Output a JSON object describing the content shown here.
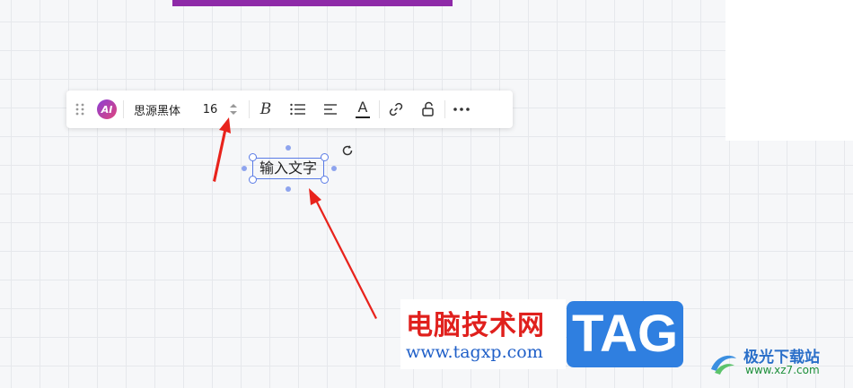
{
  "toolbar": {
    "ai_label": "AI",
    "font_family": "思源黑体",
    "font_size": "16",
    "bold_label": "B",
    "text_color_label": "A"
  },
  "canvas": {
    "text_box_value": "输入文字"
  },
  "watermark": {
    "site_name": "电脑技术网",
    "site_url": "www.tagxp.com",
    "tag_logo": "TAG",
    "xz_name": "极光下载站",
    "xz_url": "www.xz7.com"
  },
  "colors": {
    "accent": "#5a7be6",
    "purple_shape": "#8e2aa8",
    "arrow": "#e8231c"
  }
}
